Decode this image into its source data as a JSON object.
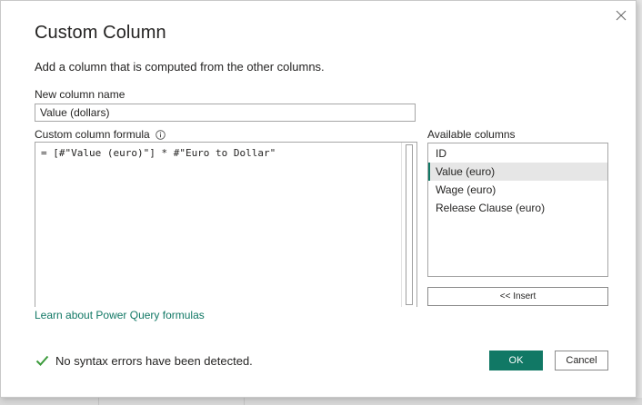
{
  "dialog": {
    "title": "Custom Column",
    "subtitle": "Add a column that is computed from the other columns."
  },
  "name_field": {
    "label": "New column name",
    "value": "Value (dollars)"
  },
  "formula_field": {
    "label": "Custom column formula",
    "value": "= [#\"Value (euro)\"] * #\"Euro to Dollar\""
  },
  "available_columns": {
    "label": "Available columns",
    "items": [
      "ID",
      "Value (euro)",
      "Wage (euro)",
      "Release Clause (euro)"
    ],
    "selected": "Value (euro)"
  },
  "buttons": {
    "insert": "<< Insert",
    "ok": "OK",
    "cancel": "Cancel"
  },
  "link": {
    "learn": "Learn about Power Query formulas"
  },
  "status": {
    "text": "No syntax errors have been detected.",
    "icon": "checkmark-icon"
  },
  "colors": {
    "accent": "#117865",
    "selected_row_bg": "#e6e6e6",
    "text": "#252423",
    "border": "#a6a6a6"
  }
}
